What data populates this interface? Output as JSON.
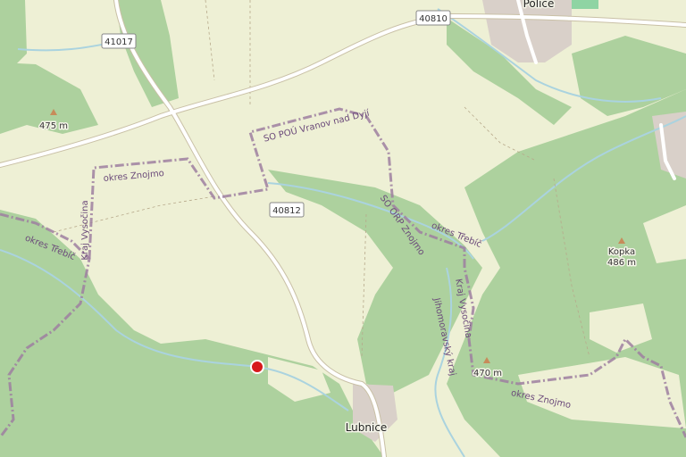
{
  "places": {
    "police": "Police",
    "lubnice": "Lubnice"
  },
  "roads": {
    "r41017": "41017",
    "r40810": "40810",
    "r40812": "40812"
  },
  "peaks": {
    "p475": "475 m",
    "kopka_name": "Kopka",
    "kopka_ele": "486 m",
    "p470": "470 m"
  },
  "admin": {
    "okres_znojmo_a": "okres Znojmo",
    "okres_znojmo_b": "okres Znojmo",
    "kraj_vysocina_a": "Kraj Vysočina",
    "kraj_vysocina_b": "Kraj Vysočina",
    "okres_trebic_a": "okres Třebíč",
    "okres_trebic_b": "okres Třebíč",
    "so_pou": "SO POÚ Vranov nad Dyjí",
    "so_orp": "SO ORP Znojmo",
    "jihomoravsky": "Jihomoravský kraj"
  },
  "marker": {
    "color": "#d7191c"
  },
  "colors": {
    "land": "#eef0d5",
    "forest": "#add19e",
    "water": "#aad3df",
    "road": "#ffffff",
    "boundary": "#9e7fa0",
    "town": "#d9d0c9"
  }
}
